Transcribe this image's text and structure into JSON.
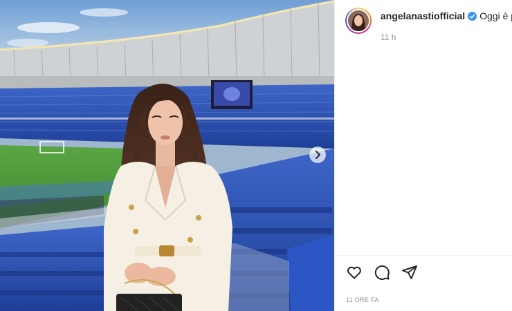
{
  "post": {
    "username": "angelanastiofficial",
    "caption": "Oggi è pi",
    "time_ago": "11 h",
    "date_label": "11 ORE FA"
  },
  "icons": {
    "verified": "verified-badge-icon",
    "like": "heart-icon",
    "comment": "comment-icon",
    "share": "share-icon",
    "next": "chevron-right-icon"
  },
  "colors": {
    "text": "#262626",
    "secondary_text": "#8e8e8e",
    "verified_blue": "#3897f0",
    "stadium_seats": "#2a4fb0",
    "pitch": "#4f9a3a"
  }
}
